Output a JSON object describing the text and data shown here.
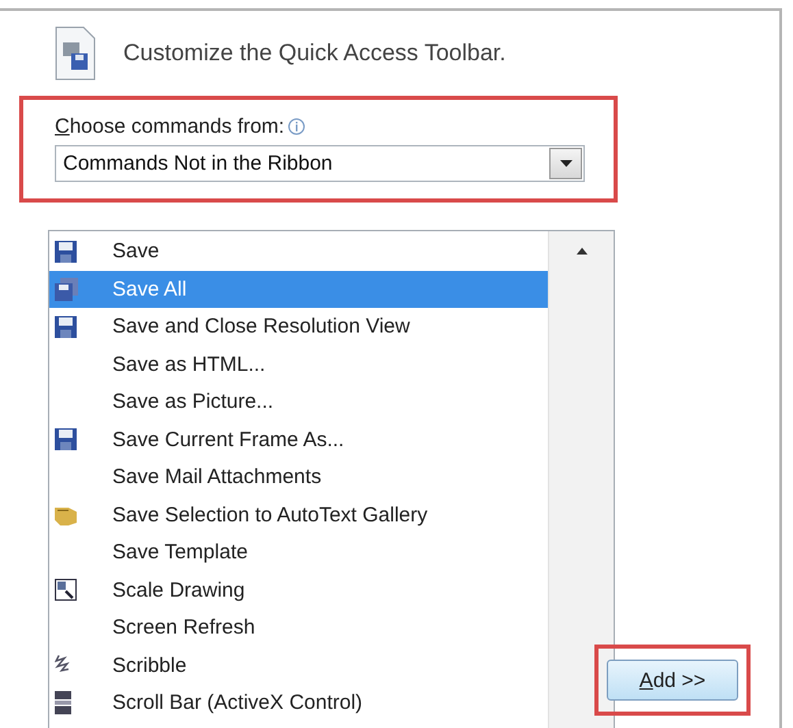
{
  "header": {
    "title": "Customize the Quick Access Toolbar."
  },
  "chooser": {
    "label": "Choose commands from:",
    "value": "Commands Not in the Ribbon"
  },
  "commands": [
    {
      "label": "Save",
      "kind": "floppy",
      "selected": false
    },
    {
      "label": "Save All",
      "kind": "save-all",
      "selected": true
    },
    {
      "label": "Save and Close Resolution View",
      "kind": "floppy",
      "selected": false
    },
    {
      "label": "Save as HTML...",
      "kind": "none",
      "selected": false
    },
    {
      "label": "Save as Picture...",
      "kind": "none",
      "selected": false
    },
    {
      "label": "Save Current Frame As...",
      "kind": "floppy",
      "selected": false
    },
    {
      "label": "Save Mail Attachments",
      "kind": "none",
      "selected": false
    },
    {
      "label": "Save Selection to AutoText Gallery",
      "kind": "hand",
      "selected": false
    },
    {
      "label": "Save Template",
      "kind": "none",
      "selected": false
    },
    {
      "label": "Scale Drawing",
      "kind": "scale",
      "selected": false
    },
    {
      "label": "Screen Refresh",
      "kind": "none",
      "selected": false
    },
    {
      "label": "Scribble",
      "kind": "scribble",
      "selected": false
    },
    {
      "label": "Scroll Bar (ActiveX Control)",
      "kind": "scrollbar",
      "selected": false
    }
  ],
  "add_button": {
    "label": "Add >>"
  }
}
